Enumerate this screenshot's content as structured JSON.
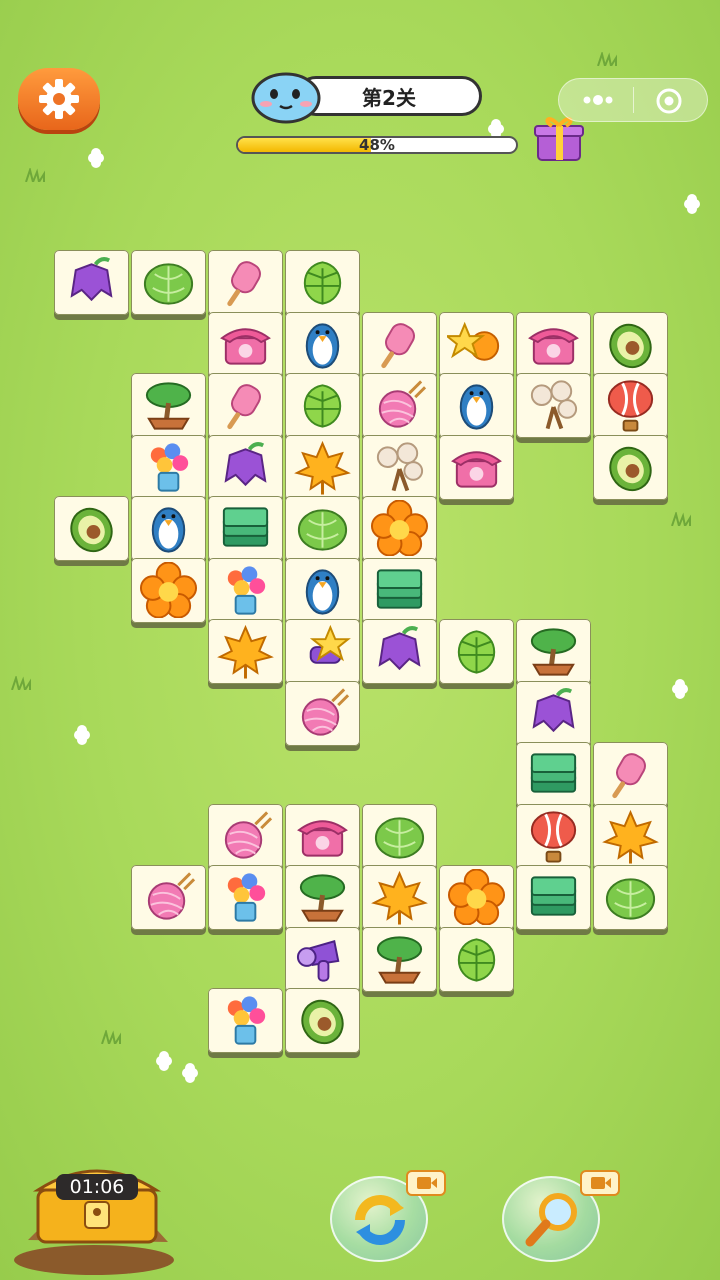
{
  "header": {
    "level_label": "第2关",
    "progress_text": "48%",
    "progress_value": 0.48
  },
  "timer": {
    "value": "01:06"
  },
  "icons": {
    "settings": "gear-icon",
    "avatar": "blue-creature-avatar",
    "gift": "gift-box-icon",
    "menu": "more-dots-icon",
    "close": "target-circle-icon",
    "shuffle": "shuffle-arrows-icon",
    "hint": "magnifier-icon",
    "video": "video-ad-icon",
    "chest": "treasure-chest-icon"
  },
  "tiles": [
    [
      "bellflower",
      "cabbage",
      "popsicle",
      "monstera",
      "",
      "",
      "",
      "",
      ""
    ],
    [
      "",
      "",
      "phone",
      "penguin",
      "popsicle",
      "star-flower",
      "phone",
      "avocado",
      ""
    ],
    [
      "",
      "bonsai",
      "popsicle",
      "monstera",
      "yarn",
      "penguin",
      "cotton",
      "balloon",
      ""
    ],
    [
      "",
      "bouquet",
      "bellflower",
      "maple",
      "cotton",
      "phone",
      "",
      "avocado",
      ""
    ],
    [
      "avocado",
      "penguin",
      "money",
      "cabbage",
      "orange-flower",
      "",
      "",
      "",
      ""
    ],
    [
      "",
      "orange-flower",
      "bouquet",
      "penguin",
      "money",
      "",
      "",
      "",
      ""
    ],
    [
      "",
      "",
      "maple",
      "star-dryer",
      "bellflower",
      "monstera",
      "bonsai",
      "",
      ""
    ],
    [
      "",
      "",
      "",
      "yarn",
      "",
      "",
      "bellflower",
      "",
      ""
    ],
    [
      "",
      "",
      "",
      "",
      "",
      "",
      "money",
      "popsicle",
      ""
    ],
    [
      "",
      "",
      "yarn",
      "phone",
      "cabbage",
      "",
      "balloon",
      "maple",
      ""
    ],
    [
      "",
      "yarn",
      "bouquet",
      "bonsai",
      "maple",
      "orange-flower",
      "money",
      "cabbage",
      ""
    ],
    [
      "",
      "",
      "",
      "hairdryer",
      "bonsai",
      "monstera",
      "",
      "",
      ""
    ],
    [
      "",
      "",
      "bouquet",
      "avocado",
      "",
      "",
      "",
      "",
      ""
    ]
  ]
}
